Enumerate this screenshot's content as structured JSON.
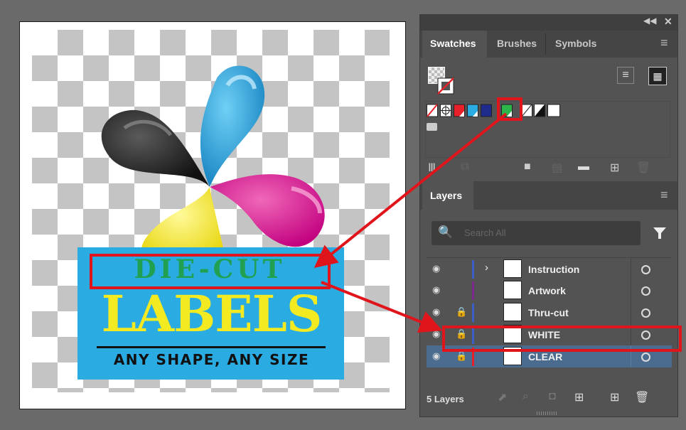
{
  "artwork": {
    "die_cut": "DIE-CUT",
    "labels": "LABELS",
    "tagline": "ANY SHAPE, ANY SIZE"
  },
  "panel": {
    "top_icons": [
      "collapse-icon",
      "close-icon"
    ],
    "swatches_tabs": [
      {
        "label": "Swatches",
        "active": true
      },
      {
        "label": "Brushes",
        "active": false
      },
      {
        "label": "Symbols",
        "active": false
      }
    ],
    "swatch_colors": [
      "none",
      "registration",
      "#e8202a",
      "#2aace2",
      "#1f2b8a",
      "#2bb54a",
      "#ffffff",
      "#111111",
      "#ffffff"
    ],
    "layers_tab": "Layers",
    "search_placeholder": "Search All",
    "layers": [
      {
        "name": "Instruction",
        "locked": false,
        "expandable": true,
        "color": "#3c5ec9",
        "selected": false
      },
      {
        "name": "Artwork",
        "locked": false,
        "expandable": false,
        "color": "#7a2a8c",
        "selected": false
      },
      {
        "name": "Thru-cut",
        "locked": true,
        "expandable": false,
        "color": "#3c5ec9",
        "selected": false
      },
      {
        "name": "WHITE",
        "locked": true,
        "expandable": false,
        "color": "#3c5ec9",
        "selected": false
      },
      {
        "name": "CLEAR",
        "locked": true,
        "expandable": false,
        "color": "#e8202a",
        "selected": true
      }
    ],
    "layer_count": "5 Layers"
  },
  "colors": {
    "highlight": "#e0151b",
    "selected_row": "#4b6c8e",
    "panel_bg": "#535353"
  }
}
